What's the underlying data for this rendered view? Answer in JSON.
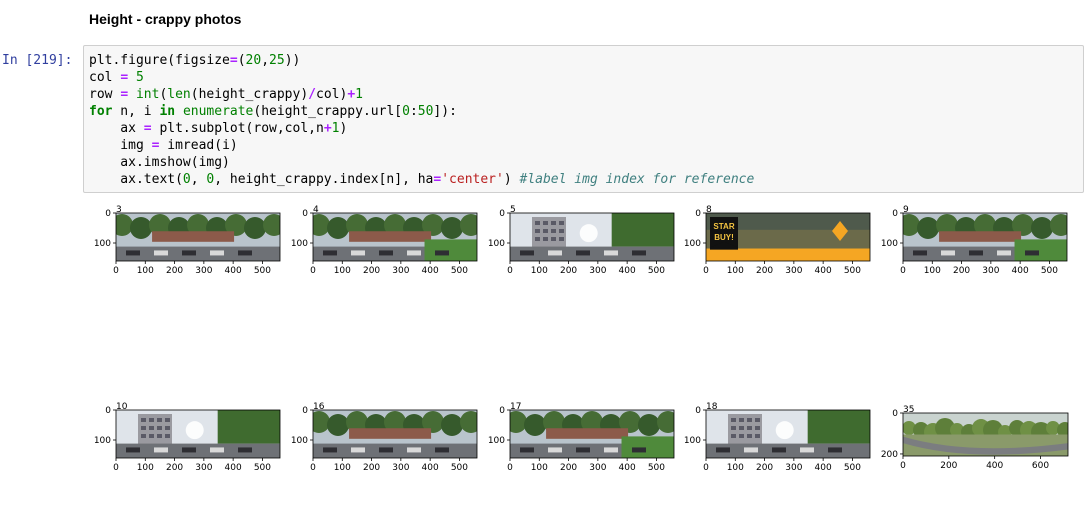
{
  "markdown": {
    "heading": "Height - crappy photos"
  },
  "cell": {
    "prompt": "In [219]:",
    "code": [
      [
        {
          "t": "plt.figure(figsize",
          "c": "p"
        },
        {
          "t": "=",
          "c": "op"
        },
        {
          "t": "(",
          "c": "p"
        },
        {
          "t": "20",
          "c": "num"
        },
        {
          "t": ",",
          "c": "p"
        },
        {
          "t": "25",
          "c": "num"
        },
        {
          "t": "))",
          "c": "p"
        }
      ],
      [
        {
          "t": "col ",
          "c": "p"
        },
        {
          "t": "=",
          "c": "op"
        },
        {
          "t": " ",
          "c": "p"
        },
        {
          "t": "5",
          "c": "num"
        }
      ],
      [
        {
          "t": "row ",
          "c": "p"
        },
        {
          "t": "=",
          "c": "op"
        },
        {
          "t": " ",
          "c": "p"
        },
        {
          "t": "int",
          "c": "bi"
        },
        {
          "t": "(",
          "c": "p"
        },
        {
          "t": "len",
          "c": "bi"
        },
        {
          "t": "(height_crappy)",
          "c": "p"
        },
        {
          "t": "/",
          "c": "op"
        },
        {
          "t": "col)",
          "c": "p"
        },
        {
          "t": "+",
          "c": "op"
        },
        {
          "t": "1",
          "c": "num"
        }
      ],
      [
        {
          "t": "for",
          "c": "kw"
        },
        {
          "t": " n, i ",
          "c": "p"
        },
        {
          "t": "in",
          "c": "kw"
        },
        {
          "t": " ",
          "c": "p"
        },
        {
          "t": "enumerate",
          "c": "bi"
        },
        {
          "t": "(height_crappy.url[",
          "c": "p"
        },
        {
          "t": "0",
          "c": "num"
        },
        {
          "t": ":",
          "c": "p"
        },
        {
          "t": "50",
          "c": "num"
        },
        {
          "t": "]):",
          "c": "p"
        }
      ],
      [
        {
          "t": "    ax ",
          "c": "p"
        },
        {
          "t": "=",
          "c": "op"
        },
        {
          "t": " plt.subplot(row,col,n",
          "c": "p"
        },
        {
          "t": "+",
          "c": "op"
        },
        {
          "t": "1",
          "c": "num"
        },
        {
          "t": ")",
          "c": "p"
        }
      ],
      [
        {
          "t": "    img ",
          "c": "p"
        },
        {
          "t": "=",
          "c": "op"
        },
        {
          "t": " imread(i)",
          "c": "p"
        }
      ],
      [
        {
          "t": "    ax.imshow(img)",
          "c": "p"
        }
      ],
      [
        {
          "t": "    ax.text(",
          "c": "p"
        },
        {
          "t": "0",
          "c": "num"
        },
        {
          "t": ", ",
          "c": "p"
        },
        {
          "t": "0",
          "c": "num"
        },
        {
          "t": ", height_crappy.index[n], ha",
          "c": "p"
        },
        {
          "t": "=",
          "c": "op"
        },
        {
          "t": "'center'",
          "c": "str"
        },
        {
          "t": ") ",
          "c": "p"
        },
        {
          "t": "#label img index for reference",
          "c": "cm"
        }
      ]
    ]
  },
  "output": {
    "subplots": [
      {
        "index_label": "3",
        "yticks": [
          "0",
          "100"
        ],
        "xticks": [
          "0",
          "100",
          "200",
          "300",
          "400",
          "500"
        ],
        "scene": "street-trees"
      },
      {
        "index_label": "4",
        "yticks": [
          "0",
          "100"
        ],
        "xticks": [
          "0",
          "100",
          "200",
          "300",
          "400",
          "500"
        ],
        "scene": "street-grass"
      },
      {
        "index_label": "5",
        "yticks": [
          "0",
          "100"
        ],
        "xticks": [
          "0",
          "100",
          "200",
          "300",
          "400",
          "500"
        ],
        "scene": "building-sun"
      },
      {
        "index_label": "8",
        "yticks": [
          "0",
          "100"
        ],
        "xticks": [
          "0",
          "100",
          "200",
          "300",
          "400",
          "500"
        ],
        "scene": "star-buy-ad",
        "ad_text": [
          "STAR",
          "BUY!"
        ]
      },
      {
        "index_label": "9",
        "yticks": [
          "0",
          "100"
        ],
        "xticks": [
          "0",
          "100",
          "200",
          "300",
          "400",
          "500"
        ],
        "scene": "street-grass"
      },
      {
        "index_label": "10",
        "yticks": [
          "0",
          "100"
        ],
        "xticks": [
          "0",
          "100",
          "200",
          "300",
          "400",
          "500"
        ],
        "scene": "building-sun"
      },
      {
        "index_label": "16",
        "yticks": [
          "0",
          "100"
        ],
        "xticks": [
          "0",
          "100",
          "200",
          "300",
          "400",
          "500"
        ],
        "scene": "street-trees"
      },
      {
        "index_label": "17",
        "yticks": [
          "0",
          "100"
        ],
        "xticks": [
          "0",
          "100",
          "200",
          "300",
          "400",
          "500"
        ],
        "scene": "street-grass"
      },
      {
        "index_label": "18",
        "yticks": [
          "0",
          "100"
        ],
        "xticks": [
          "0",
          "100",
          "200",
          "300",
          "400",
          "500"
        ],
        "scene": "building-sun"
      },
      {
        "index_label": "35",
        "yticks": [
          "0",
          "200"
        ],
        "xticks": [
          "0",
          "200",
          "400",
          "600"
        ],
        "scene": "park-road"
      }
    ]
  },
  "colors": {
    "prompt": "#303F9F",
    "keyword": "#008000",
    "operator": "#AA22FF",
    "string": "#BA2121",
    "comment": "#408080"
  }
}
